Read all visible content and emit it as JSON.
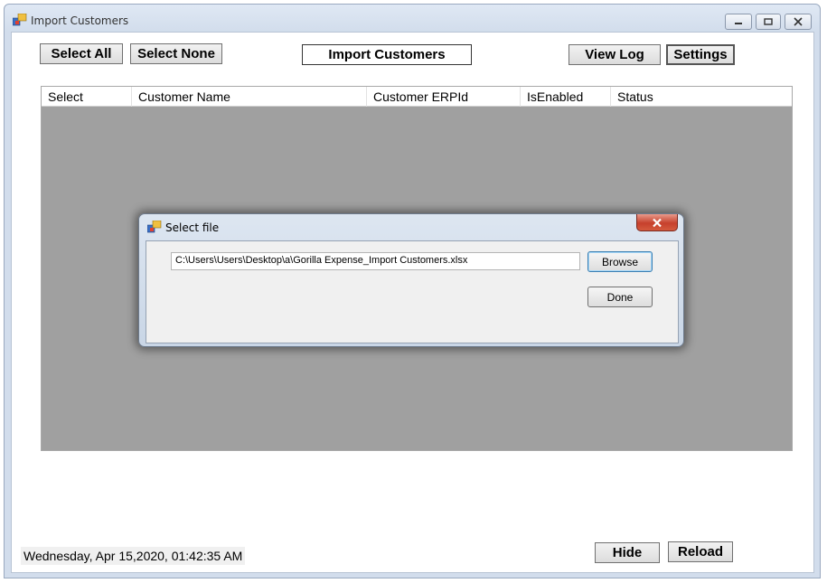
{
  "window": {
    "title": "Import Customers",
    "icon": "app-window-icon"
  },
  "toolbar": {
    "select_all": "Select All",
    "select_none": "Select None",
    "import_customers": "Import Customers",
    "view_log": "View Log",
    "settings": "Settings"
  },
  "grid": {
    "columns": [
      "Select",
      "Customer Name",
      "Customer ERPId",
      "IsEnabled",
      "Status"
    ],
    "rows": []
  },
  "dialog": {
    "title": "Select file",
    "file_path": "C:\\Users\\Users\\Desktop\\a\\Gorilla Expense_Import Customers.xlsx",
    "browse": "Browse",
    "done": "Done"
  },
  "footer": {
    "datetime": "Wednesday, Apr 15,2020, 01:42:35 AM",
    "hide": "Hide",
    "reload": "Reload"
  }
}
